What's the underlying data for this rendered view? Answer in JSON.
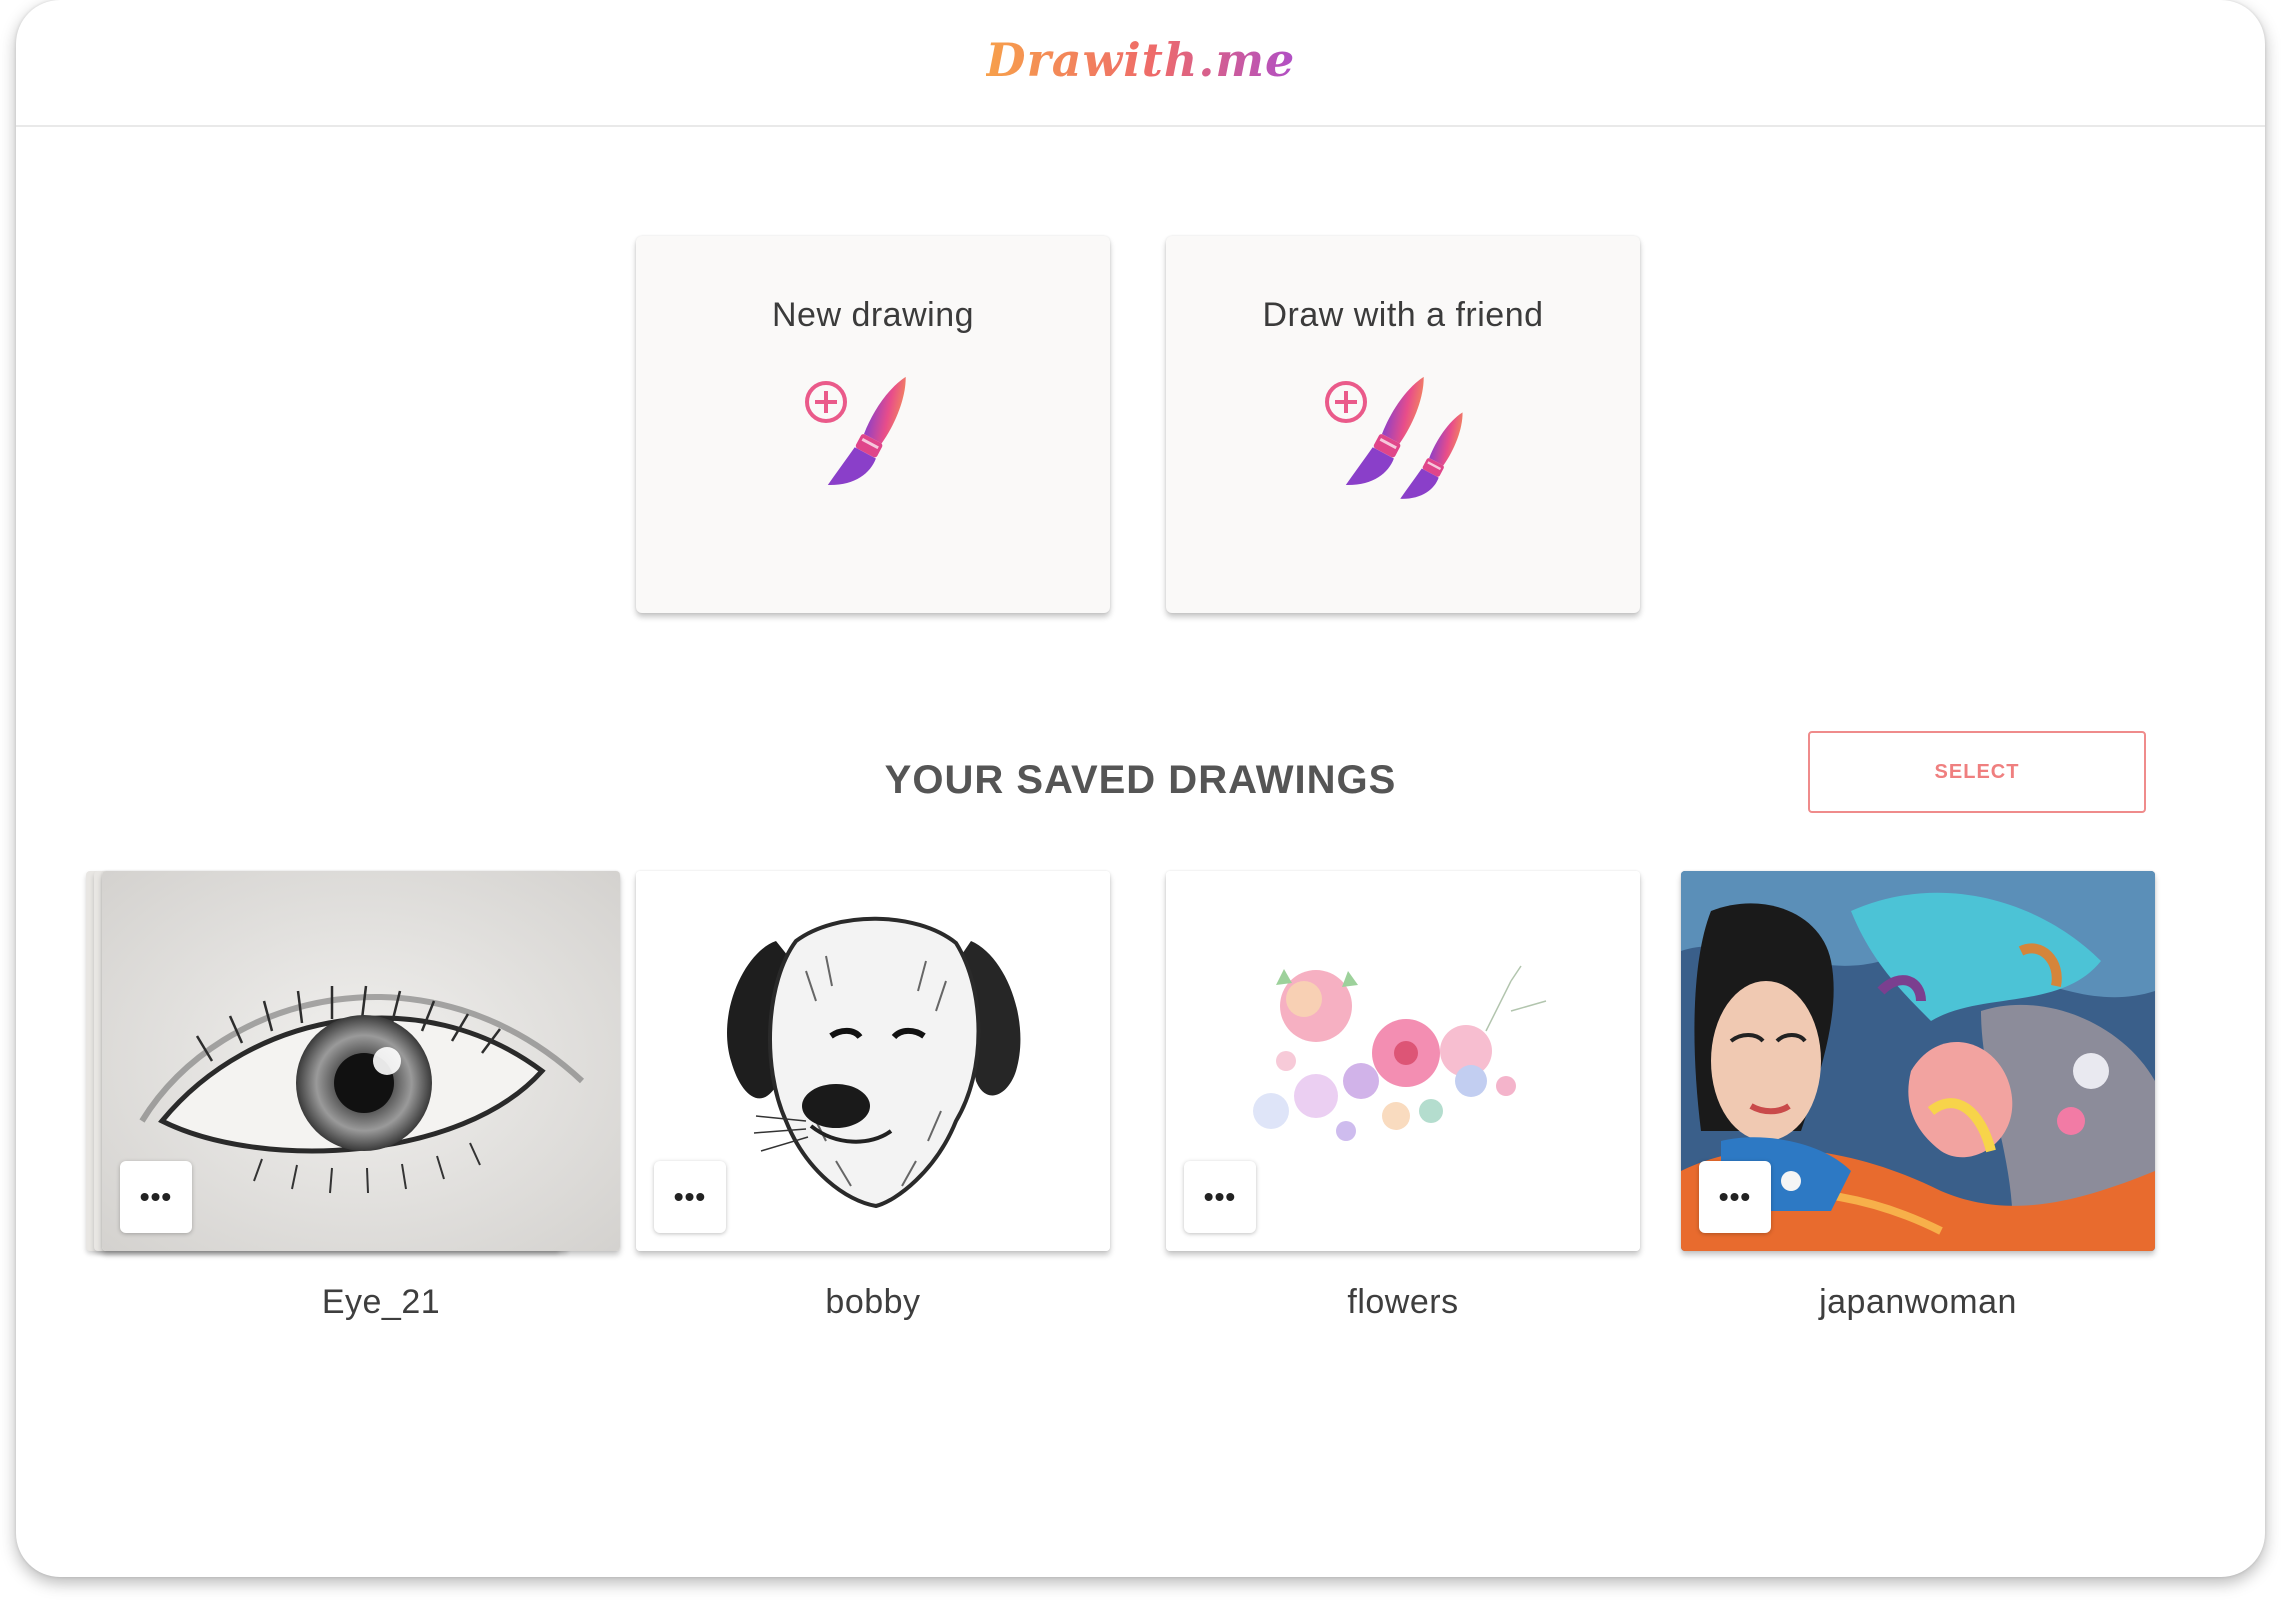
{
  "app": {
    "logo": "Drawith.me"
  },
  "actions": [
    {
      "label": "New drawing",
      "icon": "single-brush-add-icon"
    },
    {
      "label": "Draw with a friend",
      "icon": "two-brushes-add-icon"
    }
  ],
  "saved": {
    "section_title": "YOUR SAVED DRAWINGS",
    "select_label": "SELECT",
    "more_label": "•••",
    "drawings": [
      {
        "name": "Eye_21",
        "thumb": "eye-sketch"
      },
      {
        "name": "bobby",
        "thumb": "dog-sketch"
      },
      {
        "name": "flowers",
        "thumb": "watercolor-flowers"
      },
      {
        "name": "japanwoman",
        "thumb": "colorful-japanese-woman-illustration"
      }
    ]
  },
  "colors": {
    "brand_orange": "#f7a04b",
    "brand_pink": "#ee6a6a",
    "brand_purple": "#b04fc6",
    "select_border": "#ef8b8b"
  }
}
